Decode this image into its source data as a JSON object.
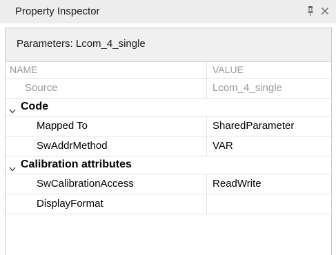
{
  "window": {
    "title": "Property Inspector",
    "pin_icon": "pin-icon",
    "close_icon": "close-icon"
  },
  "header": {
    "label": "Parameters: Lcom_4_single"
  },
  "table": {
    "columns": {
      "name": "NAME",
      "value": "VALUE"
    },
    "source": {
      "name": "Source",
      "value": "Lcom_4_single"
    },
    "groups": [
      {
        "title": "Code",
        "rows": [
          {
            "name": "Mapped To",
            "value": "SharedParameter"
          },
          {
            "name": "SwAddrMethod",
            "value": "VAR"
          }
        ]
      },
      {
        "title": "Calibration attributes",
        "rows": [
          {
            "name": "SwCalibrationAccess",
            "value": "ReadWrite"
          },
          {
            "name": "DisplayFormat",
            "value": ""
          }
        ]
      }
    ]
  },
  "colors": {
    "titlebar_bg": "#ededed",
    "header_bg": "#f0f0f0",
    "grid_line": "#e2e2e2",
    "muted_text": "#9a9a9a"
  }
}
